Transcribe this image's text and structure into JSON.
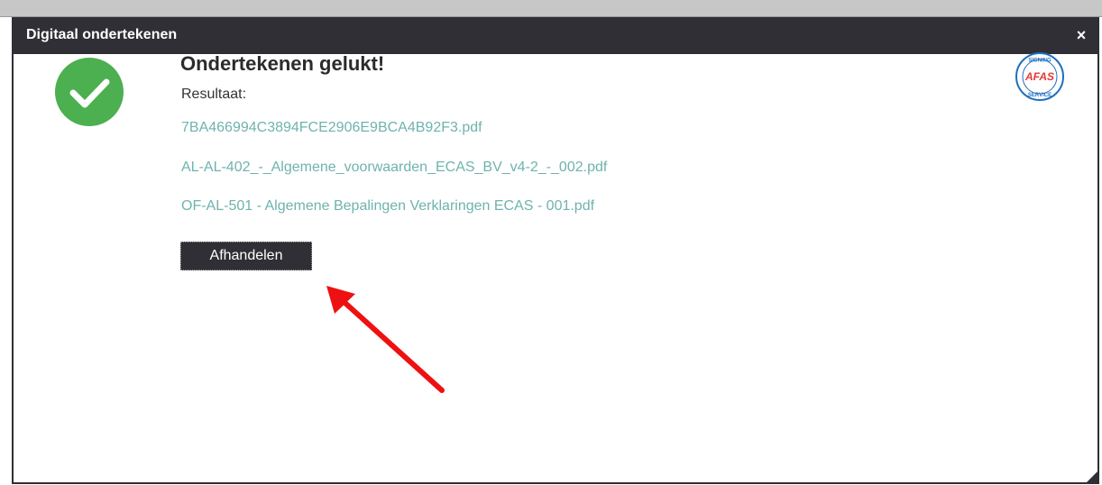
{
  "dialog": {
    "title": "Digitaal ondertekenen",
    "close_label": "×"
  },
  "content": {
    "heading": "Ondertekenen gelukt!",
    "result_label": "Resultaat:",
    "files": [
      "7BA466994C3894FCE2906E9BCA4B92F3.pdf",
      "AL-AL-402_-_Algemene_voorwaarden_ECAS_BV_v4-2_-_002.pdf",
      "OF-AL-501 - Algemene Bepalingen Verklaringen ECAS - 001.pdf"
    ],
    "action_button": "Afhandelen"
  },
  "badge": {
    "text": "AFAS",
    "ring_text_top": "SIGNING",
    "ring_text_bottom": "SERVICE"
  },
  "colors": {
    "titlebar": "#2f2f35",
    "success_green": "#4caf50",
    "link": "#6fb3ae",
    "annotation_arrow": "#ee1111",
    "badge_blue": "#1f6fbf"
  },
  "icons": {
    "success": "checkmark-circle-icon",
    "close": "close-icon",
    "resize": "resize-grip-icon",
    "annotation": "red-arrow-icon"
  }
}
